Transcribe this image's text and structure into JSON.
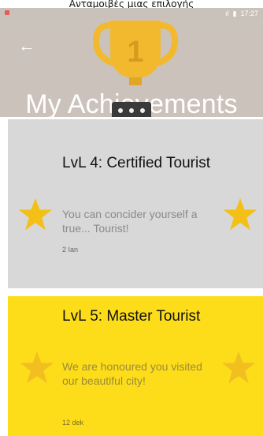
{
  "caption": "Ανταμοιβές μιας επιλογής",
  "status": {
    "signal": "ıl",
    "battery": "▮",
    "time": "17:27"
  },
  "header": {
    "back_icon": "arrow-left-icon",
    "trophy_number": "1",
    "title": "My Achievements"
  },
  "achievements": [
    {
      "title": "LvL 4: Certified Tourist",
      "description": "You can concider yourself a true... Tourist!",
      "date": "2 Ian"
    },
    {
      "title": "LvL 5: Master Tourist",
      "description": "We are honoured you visited our beautiful city!",
      "date": "12 dek"
    }
  ],
  "colors": {
    "header_bg": "#cbc3bb",
    "trophy": "#f2b92f",
    "card_grey": "#d8d8d8",
    "card_yellow": "#fddd1a",
    "star": "#f3c018"
  }
}
